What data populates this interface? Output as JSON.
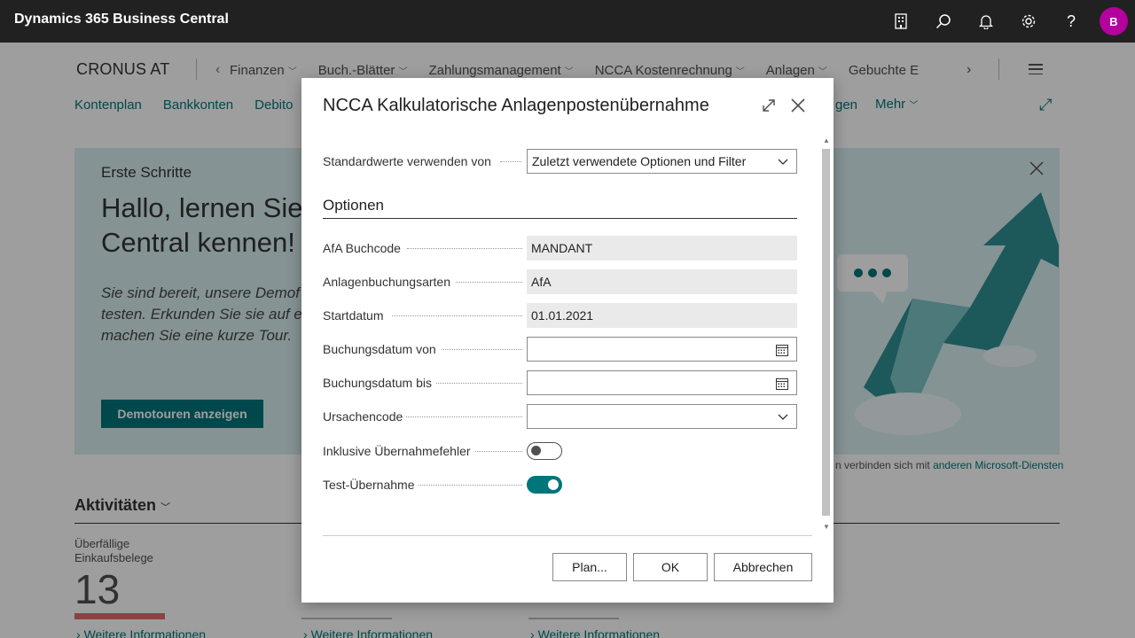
{
  "app": {
    "title": "Dynamics 365 Business Central",
    "avatar_initial": "B"
  },
  "topbar_icons": [
    "building-icon",
    "search-icon",
    "bell-icon",
    "gear-icon",
    "help-icon"
  ],
  "page": {
    "company": "CRONUS AT",
    "nav": [
      "Finanzen",
      "Buch.-Blätter",
      "Zahlungsmanagement",
      "NCCA Kostenrechnung",
      "Anlagen",
      "Gebuchte E"
    ],
    "actions": [
      "Kontenplan",
      "Bankkonten",
      "Debito"
    ],
    "partial_action": "gen",
    "more_action": "Mehr",
    "banner": {
      "title": "Erste Schritte",
      "headline": "Hallo, lernen Sie Central kennen!",
      "description": "Sie sind bereit, unsere Demof testen. Erkunden Sie sie auf e machen Sie eine kurze Tour.",
      "button": "Demotouren anzeigen"
    },
    "footnote_prefix": "n verbinden sich mit ",
    "footnote_link": "anderen Microsoft-Diensten",
    "activities_title": "Aktivitäten",
    "cue": {
      "label_line1": "Überfällige",
      "label_line2": "Einkaufsbelege",
      "value": "13"
    },
    "more_info": "Weitere Informationen"
  },
  "dialog": {
    "title": "NCCA Kalkulatorische Anlagenpostenübernahme",
    "defaults_label": "Standardwerte verwenden von",
    "defaults_value": "Zuletzt verwendete Optionen und Filter",
    "section": "Optionen",
    "fields": {
      "afa_buchcode": {
        "label": "AfA Buchcode",
        "value": "MANDANT"
      },
      "anlagenbuchungsarten": {
        "label": "Anlagenbuchungsarten",
        "value": "AfA"
      },
      "startdatum": {
        "label": "Startdatum",
        "value": "01.01.2021"
      },
      "buchungsdatum_von": {
        "label": "Buchungsdatum von",
        "value": ""
      },
      "buchungsdatum_bis": {
        "label": "Buchungsdatum bis",
        "value": ""
      },
      "ursachencode": {
        "label": "Ursachencode",
        "value": ""
      },
      "inklusive_fehler": {
        "label": "Inklusive Übernahmefehler",
        "on": false
      },
      "test_uebernahme": {
        "label": "Test-Übernahme",
        "on": true
      }
    },
    "buttons": {
      "plan": "Plan...",
      "ok": "OK",
      "cancel": "Abbrechen"
    }
  },
  "colors": {
    "accent": "#00757a",
    "topbar": "#212121",
    "avatar": "#b4009e",
    "cue_bar": "#e06b6b"
  }
}
